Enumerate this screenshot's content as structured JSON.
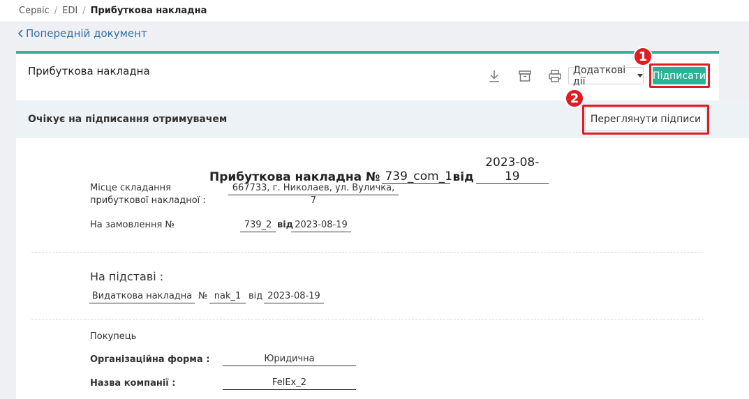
{
  "breadcrumb": {
    "item1": "Сервіс",
    "item2": "EDI",
    "current": "Прибуткова накладна",
    "sep": "/"
  },
  "nav": {
    "prev_document": "Попередній документ"
  },
  "header": {
    "title": "Прибуткова накладна",
    "download_icon": "download-icon",
    "archive_icon": "archive-icon",
    "print_icon": "printer-icon",
    "more_actions": "Додаткові дії",
    "sign_button": "Підписати",
    "accent_color": "#2db79a"
  },
  "badges": {
    "one": "1",
    "two": "2"
  },
  "status": {
    "text": "Очікує на підписання отримувачем",
    "view_signatures": "Переглянути підписи"
  },
  "document": {
    "title_prefix": "Прибуткова накладна №",
    "number": "739_com_1",
    "from_word": "від",
    "date": "2023-08-19",
    "place_label_line1": "Місце складання",
    "place_label_line2": "прибуткової накладної :",
    "place_value": "667733, г. Николаев, ул. Вуличка, 7",
    "order_label": "На замовлення №",
    "order_number": "739_2",
    "order_from": "від",
    "order_date": "2023-08-19",
    "basis_label": "На підставі :",
    "basis_doc": "Видаткова накладна",
    "basis_no_sign": "№",
    "basis_number": "nak_1",
    "basis_from": "від",
    "basis_date": "2023-08-19",
    "buyer_label": "Покупець",
    "org_form_label": "Організаційна форма :",
    "org_form_value": "Юридична",
    "company_label": "Назва компанії :",
    "company_value": "FelEx_2"
  }
}
